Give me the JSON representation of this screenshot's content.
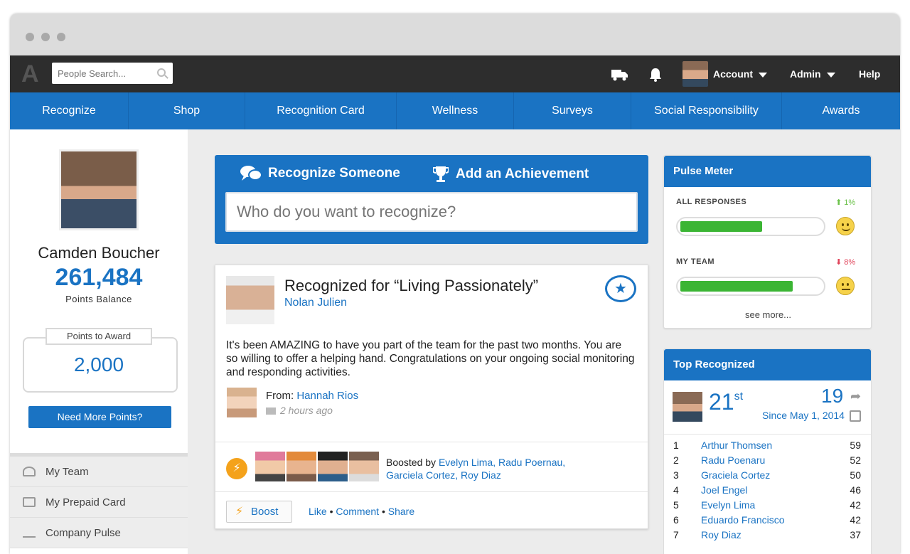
{
  "topbar": {
    "logo": "A",
    "search_placeholder": "People Search...",
    "account_label": "Account",
    "admin_label": "Admin",
    "help_label": "Help",
    "icons": [
      "truck-icon",
      "bell-icon",
      "search-icon"
    ]
  },
  "nav": {
    "tabs": [
      {
        "label": "Recognize"
      },
      {
        "label": "Shop"
      },
      {
        "label": "Recognition Card"
      },
      {
        "label": "Wellness"
      },
      {
        "label": "Surveys"
      },
      {
        "label": "Social Responsibility"
      },
      {
        "label": "Awards"
      }
    ]
  },
  "sidebar": {
    "name": "Camden Boucher",
    "points": "261,484",
    "points_label": "Points Balance",
    "award_title": "Points to Award",
    "award_value": "2,000",
    "need_more": "Need More Points?",
    "menu": [
      {
        "label": "My Team",
        "icon": "team-icon"
      },
      {
        "label": "My Prepaid Card",
        "icon": "card-icon"
      },
      {
        "label": "Company Pulse",
        "icon": "pulse-icon"
      }
    ]
  },
  "recognize": {
    "tab1": "Recognize Someone",
    "tab2": "Add an Achievement",
    "placeholder": "Who do you want to recognize?"
  },
  "post": {
    "title": "Recognized for “Living Passionately”",
    "recipient": "Nolan Julien",
    "body": "It's been AMAZING to have you part of the team for the past two months. You are so willing to offer a helping hand. Congratulations on your ongoing social monitoring and responding activities.",
    "from_label": "From:",
    "from_name": "Hannah Rios",
    "time": "2 hours ago",
    "boosted_prefix": "Boosted by",
    "boosted_names": "Evelyn Lima, Radu Poernau, Garciela Cortez, Roy Diaz",
    "boost_button": "Boost",
    "like": "Like",
    "comment": "Comment",
    "share": "Share",
    "separator": "•"
  },
  "pulse": {
    "title": "Pulse Meter",
    "all_label": "ALL RESPONSES",
    "all_trend": "1%",
    "all_value": 0.58,
    "team_label": "MY TEAM",
    "team_trend": "8%",
    "team_value": 0.8,
    "see_more": "see more...",
    "colors": {
      "bar": "#3bb534",
      "up": "#6cc24a",
      "down": "#e0445a"
    }
  },
  "top_recognized": {
    "title": "Top Recognized",
    "rank": "21",
    "rank_suffix": "st",
    "count": "19",
    "since": "Since May 1, 2014",
    "list": [
      {
        "n": "1",
        "name": "Arthur Thomsen",
        "count": "59"
      },
      {
        "n": "2",
        "name": "Radu Poenaru",
        "count": "52"
      },
      {
        "n": "3",
        "name": "Graciela Cortez",
        "count": "50"
      },
      {
        "n": "4",
        "name": "Joel Engel",
        "count": "46"
      },
      {
        "n": "5",
        "name": "Evelyn Lima",
        "count": "42"
      },
      {
        "n": "6",
        "name": "Eduardo Francisco",
        "count": "42"
      },
      {
        "n": "7",
        "name": "Roy Diaz",
        "count": "37"
      }
    ]
  },
  "colors": {
    "brand": "#1a73c3",
    "topbar": "#2d2d2d",
    "accent": "#f4a21b"
  }
}
